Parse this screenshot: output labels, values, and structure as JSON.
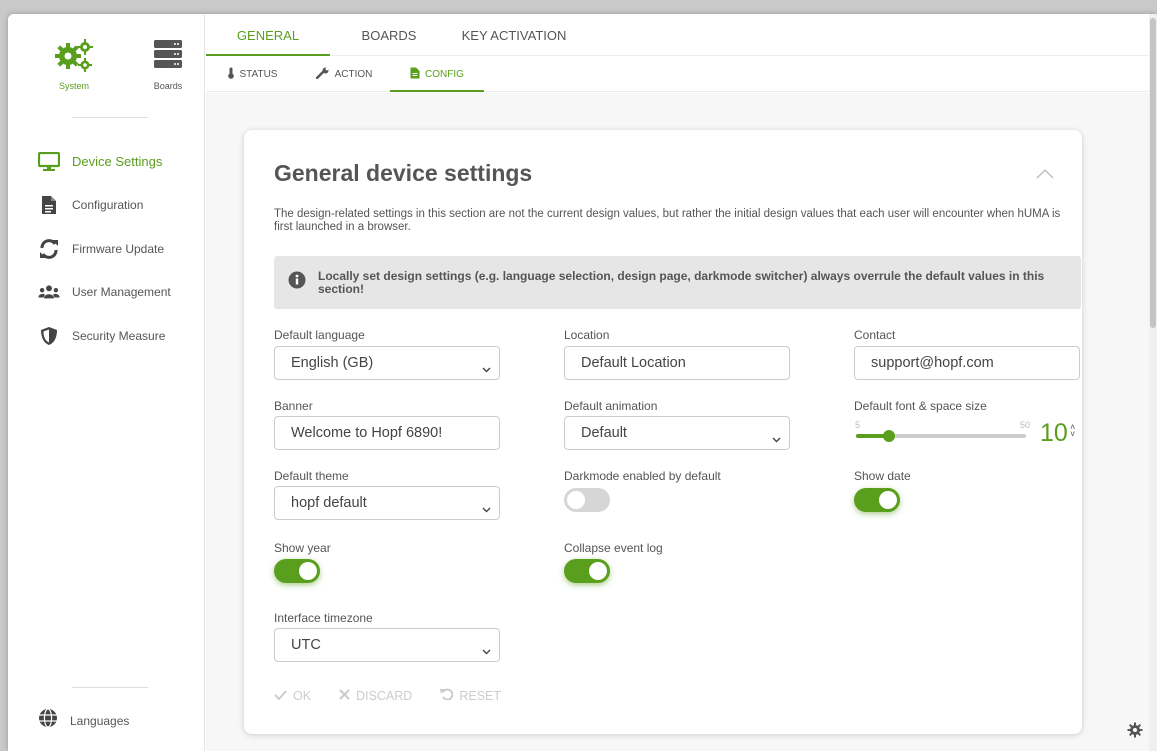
{
  "colors": {
    "accent": "#5a9e1e",
    "text": "#555555",
    "muted": "#cccccc"
  },
  "sidebar": {
    "top": [
      {
        "label": "System",
        "icon": "gears-icon"
      },
      {
        "label": "Boards",
        "icon": "server-icon"
      }
    ],
    "items": [
      {
        "label": "Device Settings",
        "icon": "monitor-icon",
        "active": true
      },
      {
        "label": "Configuration",
        "icon": "document-icon"
      },
      {
        "label": "Firmware Update",
        "icon": "refresh-icon"
      },
      {
        "label": "User Management",
        "icon": "users-icon"
      },
      {
        "label": "Security Measure",
        "icon": "shield-icon"
      }
    ],
    "languages": {
      "label": "Languages",
      "icon": "globe-icon"
    }
  },
  "tabs": [
    {
      "label": "GENERAL",
      "active": true
    },
    {
      "label": "BOARDS"
    },
    {
      "label": "KEY ACTIVATION"
    }
  ],
  "subtabs": [
    {
      "label": "STATUS",
      "icon": "thermometer-icon"
    },
    {
      "label": "ACTION",
      "icon": "wrench-icon"
    },
    {
      "label": "CONFIG",
      "icon": "document-icon",
      "active": true
    }
  ],
  "card": {
    "title": "General device settings",
    "description": "The design-related settings in this section are not the current design values, but rather the initial design values that each user will encounter when hUMA is first launched in a browser.",
    "notice": "Locally set design settings (e.g. language selection, design page, darkmode switcher) always overrule the default values in this section!",
    "fields": {
      "default_language": {
        "label": "Default language",
        "value": "English (GB)"
      },
      "location": {
        "label": "Location",
        "value": "Default Location"
      },
      "contact": {
        "label": "Contact",
        "value": "support@hopf.com"
      },
      "banner": {
        "label": "Banner",
        "value": "Welcome to Hopf 6890!"
      },
      "default_animation": {
        "label": "Default animation",
        "value": "Default"
      },
      "font_size": {
        "label": "Default font & space size",
        "min": "5",
        "max": "50",
        "value": "10"
      },
      "default_theme": {
        "label": "Default theme",
        "value": "hopf default"
      },
      "darkmode": {
        "label": "Darkmode enabled by default",
        "on": false
      },
      "show_date": {
        "label": "Show date",
        "on": true
      },
      "show_year": {
        "label": "Show year",
        "on": true
      },
      "collapse_log": {
        "label": "Collapse event log",
        "on": true
      },
      "timezone": {
        "label": "Interface timezone",
        "value": "UTC"
      }
    },
    "actions": {
      "ok": "OK",
      "discard": "DISCARD",
      "reset": "RESET"
    }
  }
}
